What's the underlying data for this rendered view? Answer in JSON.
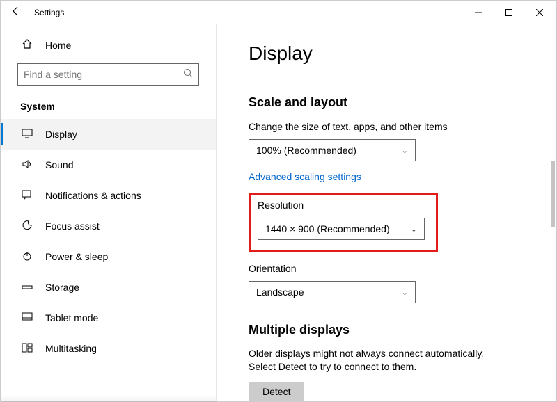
{
  "titlebar": {
    "title": "Settings"
  },
  "sidebar": {
    "home": "Home",
    "search_placeholder": "Find a setting",
    "section": "System",
    "items": [
      {
        "id": "display",
        "label": "Display",
        "selected": true
      },
      {
        "id": "sound",
        "label": "Sound"
      },
      {
        "id": "notifications",
        "label": "Notifications & actions"
      },
      {
        "id": "focus",
        "label": "Focus assist"
      },
      {
        "id": "power",
        "label": "Power & sleep"
      },
      {
        "id": "storage",
        "label": "Storage"
      },
      {
        "id": "tablet",
        "label": "Tablet mode"
      },
      {
        "id": "multitask",
        "label": "Multitasking"
      }
    ]
  },
  "content": {
    "page_title": "Display",
    "ghost_link": "",
    "scale_group": "Scale and layout",
    "scale_label": "Change the size of text, apps, and other items",
    "scale_value": "100% (Recommended)",
    "adv_scaling_link": "Advanced scaling settings",
    "resolution_label": "Resolution",
    "resolution_value": "1440 × 900 (Recommended)",
    "orientation_label": "Orientation",
    "orientation_value": "Landscape",
    "multi_group": "Multiple displays",
    "multi_help": "Older displays might not always connect automatically. Select Detect to try to connect to them.",
    "detect_btn": "Detect"
  }
}
